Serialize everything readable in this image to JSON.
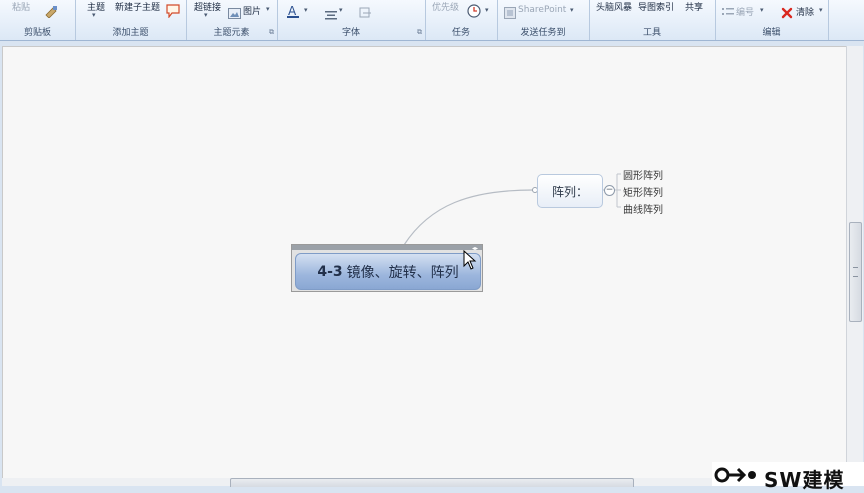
{
  "ribbon": {
    "clipboard": {
      "paste": "粘贴",
      "label": "剪贴板"
    },
    "add_topic": {
      "topic": "主题",
      "subtopic": "新建子主题",
      "label": "添加主题"
    },
    "topic_elements": {
      "hyperlink": "超链接",
      "image": "图片",
      "label": "主题元素"
    },
    "font": {
      "label": "字体"
    },
    "task": {
      "priority": "优先级",
      "label": "任务"
    },
    "send_tasks": {
      "sharepoint": "SharePoint",
      "label": "发送任务到"
    },
    "tools": {
      "brainstorm": "头脑风暴",
      "map_index": "导图索引",
      "share": "共享",
      "label": "工具"
    },
    "edit": {
      "numbering": "编号",
      "clear": "清除",
      "label": "编辑"
    }
  },
  "mindmap": {
    "central": {
      "number": "4-3",
      "text": "镜像、旋转、阵列"
    },
    "topic": "阵列：",
    "subtopics": [
      "圆形阵列",
      "矩形阵列",
      "曲线阵列"
    ]
  },
  "watermark": {
    "text": "SW建模"
  },
  "colors": {
    "ribbon_bg": "#dce8f6",
    "central_fill": "#9cb6dd",
    "canvas_bg": "#f7f7f7",
    "clear_icon": "#d9281f"
  },
  "icons": [
    "paste-icon",
    "format-painter-icon",
    "callout-icon",
    "image-icon",
    "font-color-icon",
    "align-icon",
    "priority-clock-icon",
    "sharepoint-icon",
    "numbering-icon",
    "clear-icon",
    "dialog-launcher-icon"
  ]
}
